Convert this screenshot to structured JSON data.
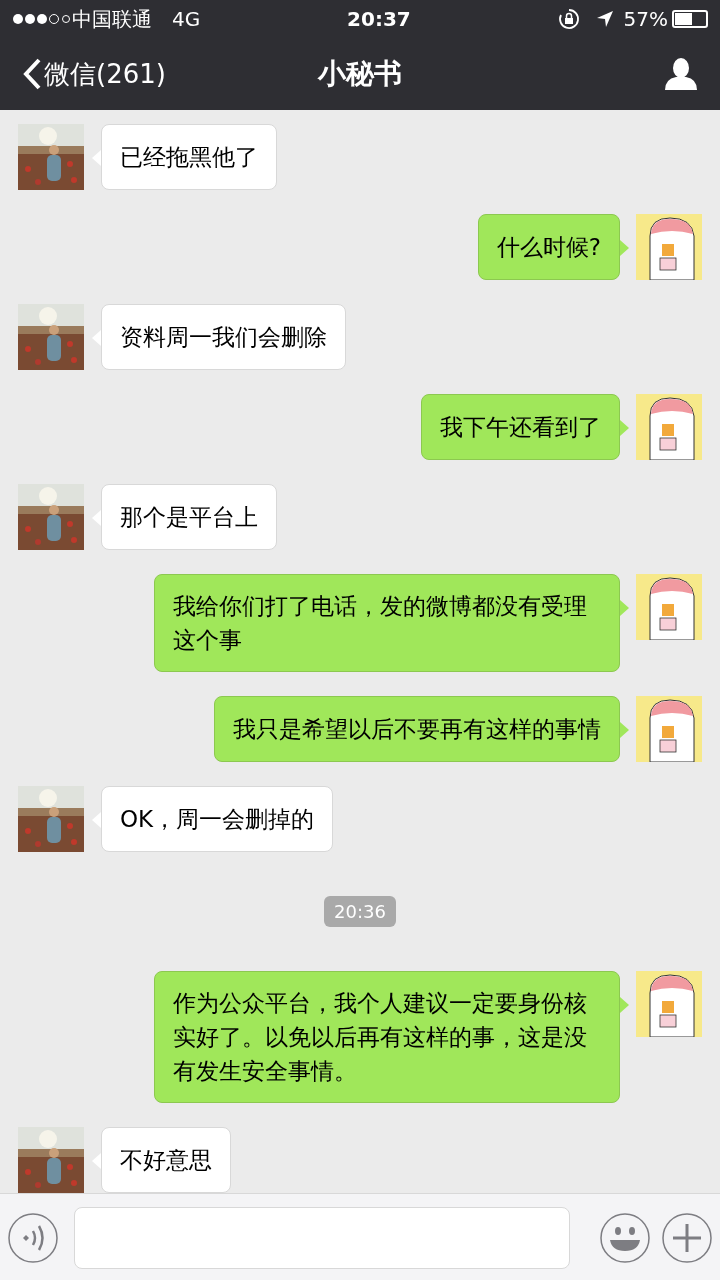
{
  "status_bar": {
    "carrier": "中国联通",
    "network": "4G",
    "time": "20:37",
    "battery": "57%"
  },
  "nav": {
    "back": "微信(261)",
    "title": "小秘书"
  },
  "messages": [
    {
      "kind": "received",
      "text": "已经拖黑他了"
    },
    {
      "kind": "sent",
      "text": "什么时候?"
    },
    {
      "kind": "received",
      "text": "资料周一我们会删除"
    },
    {
      "kind": "sent",
      "text": "我下午还看到了"
    },
    {
      "kind": "received",
      "text": "那个是平台上"
    },
    {
      "kind": "sent",
      "text": "我给你们打了电话，发的微博都没有受理这个事"
    },
    {
      "kind": "sent",
      "text": "我只是希望以后不要再有这样的事情"
    },
    {
      "kind": "received",
      "text": "OK，周一会删掉的"
    },
    {
      "kind": "time",
      "text": "20:36"
    },
    {
      "kind": "sent",
      "text": "作为公众平台，我个人建议一定要身份核实好了。以免以后再有这样的事，这是没有发生安全事情。"
    },
    {
      "kind": "received",
      "text": "不好意思"
    }
  ]
}
